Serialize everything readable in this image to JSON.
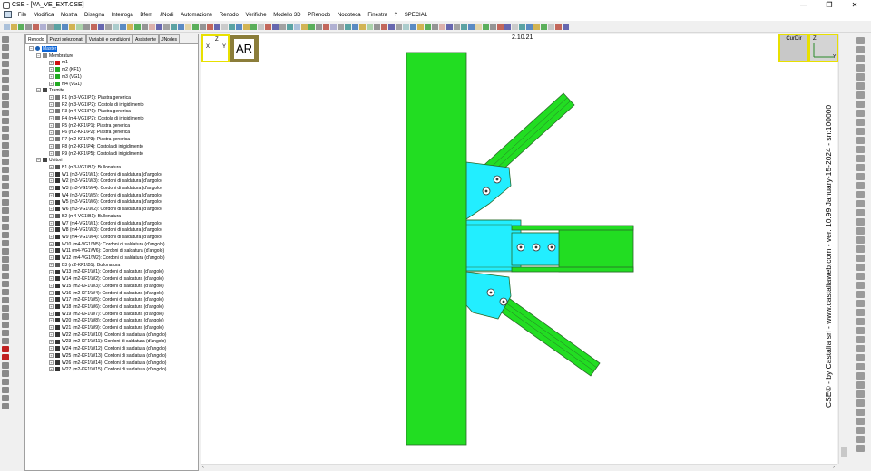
{
  "window": {
    "title": "CSE - [VA_VE_EXT.CSE]",
    "controls": [
      "—",
      "❐",
      "✕"
    ]
  },
  "menubar": {
    "items": [
      "File",
      "Modifica",
      "Mostra",
      "Disegna",
      "Interroga",
      "Bfem",
      "JNodi",
      "Automazione",
      "Renodo",
      "Verifiche",
      "Modello 3D",
      "PRenodo",
      "Nodoteca",
      "Finestra",
      "?",
      "SPECIAL"
    ]
  },
  "panel": {
    "tabs": [
      "Renodo",
      "Pezzi selezionati",
      "Variabili e condizioni",
      "Assistente",
      "JNodes"
    ],
    "active_tab": "Renodo"
  },
  "tree": {
    "root": "Master",
    "groups": [
      {
        "label": "Membrature",
        "items": [
          "m1",
          "m2 (KF1)",
          "m3 (VG1)",
          "m4 (VG1)"
        ]
      },
      {
        "label": "Tramite",
        "items": [
          "P1 (m3-VG1\\P1): Piastra generica",
          "P2 (m3-VG1\\P2): Costola di irrigidimento",
          "P3 (m4-VG1\\P1): Piastra generica",
          "P4 (m4-VG1\\P2): Costola di irrigidimento",
          "P5 (m2-KF1\\P1): Piastra generica",
          "P6 (m2-KF1\\P2): Piastra generica",
          "P7 (m2-KF1\\P3): Piastra generica",
          "P8 (m2-KF1\\P4): Costola di irrigidimento",
          "P9 (m2-KF1\\P5): Costola di irrigidimento"
        ]
      },
      {
        "label": "Unitori",
        "items": [
          "B1 (m3-VG1\\B1): Bullonatura",
          "W1 (m3-VG1\\W1): Cordoni di saldatura (d'angolo)",
          "W2 (m3-VG1\\W3): Cordoni di saldatura (d'angolo)",
          "W3 (m3-VG1\\W4): Cordoni di saldatura (d'angolo)",
          "W4 (m3-VG1\\W5): Cordoni di saldatura (d'angolo)",
          "W5 (m3-VG1\\W6): Cordoni di saldatura (d'angolo)",
          "W6 (m3-VG1\\W2): Cordoni di saldatura (d'angolo)",
          "B2 (m4-VG1\\B1): Bullonatura",
          "W7 (m4-VG1\\W1): Cordoni di saldatura (d'angolo)",
          "W8 (m4-VG1\\W3): Cordoni di saldatura (d'angolo)",
          "W9 (m4-VG1\\W4): Cordoni di saldatura (d'angolo)",
          "W10 (m4-VG1\\W5): Cordoni di saldatura (d'angolo)",
          "W11 (m4-VG1\\W6): Cordoni di saldatura (d'angolo)",
          "W12 (m4-VG1\\W2): Cordoni di saldatura (d'angolo)",
          "B3 (m2-KF1\\B1): Bullonatura",
          "W13 (m2-KF1\\W1): Cordoni di saldatura (d'angolo)",
          "W14 (m2-KF1\\W2): Cordoni di saldatura (d'angolo)",
          "W15 (m2-KF1\\W3): Cordoni di saldatura (d'angolo)",
          "W16 (m2-KF1\\W4): Cordoni di saldatura (d'angolo)",
          "W17 (m2-KF1\\W5): Cordoni di saldatura (d'angolo)",
          "W18 (m2-KF1\\W6): Cordoni di saldatura (d'angolo)",
          "W19 (m2-KF1\\W7): Cordoni di saldatura (d'angolo)",
          "W20 (m2-KF1\\W8): Cordoni di saldatura (d'angolo)",
          "W21 (m2-KF1\\W9): Cordoni di saldatura (d'angolo)",
          "W22 (m2-KF1\\W10): Cordoni di saldatura (d'angolo)",
          "W23 (m2-KF1\\W11): Cordoni di saldatura (d'angolo)",
          "W24 (m2-KF1\\W12): Cordoni di saldatura (d'angolo)",
          "W25 (m2-KF1\\W13): Cordoni di saldatura (d'angolo)",
          "W26 (m2-KF1\\W14): Cordoni di saldatura (d'angolo)",
          "W27 (m2-KF1\\W15): Cordoni di saldatura (d'angolo)"
        ]
      }
    ]
  },
  "viewport": {
    "clock": "2.10.21",
    "view_label": "AR",
    "curdir_label": "CurDir",
    "axis_z": "Z",
    "axis_x": "X",
    "axis_y": "Y",
    "version_text": "CSE© - by Castalia srl - www.castaliaweb.com - ver. 10.99 January-15-2024 - sn:100000",
    "colors": {
      "member": "#22dd22",
      "plate": "#22eeff",
      "outline": "#2a6a2a"
    }
  }
}
